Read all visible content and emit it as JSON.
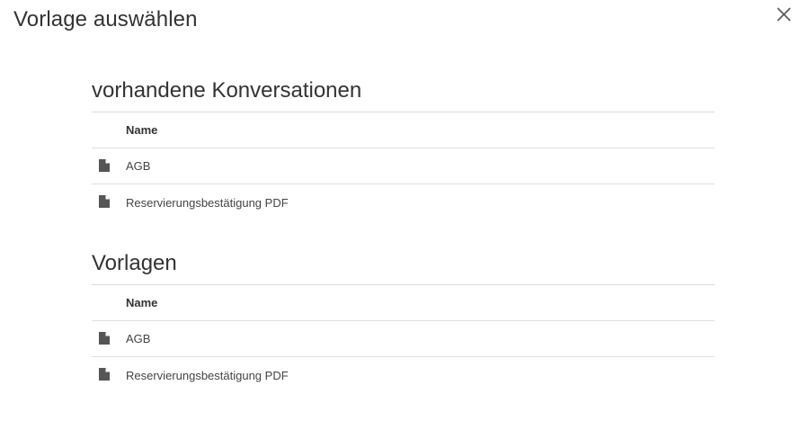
{
  "dialog": {
    "title": "Vorlage auswählen"
  },
  "sections": [
    {
      "heading": "vorhandene Konversationen",
      "column_header": "Name",
      "rows": [
        {
          "name": "AGB",
          "icon": "file-icon"
        },
        {
          "name": "Reservierungsbestätigung PDF",
          "icon": "file-icon"
        }
      ]
    },
    {
      "heading": "Vorlagen",
      "column_header": "Name",
      "rows": [
        {
          "name": "AGB",
          "icon": "file-icon"
        },
        {
          "name": "Reservierungsbestätigung PDF",
          "icon": "file-icon"
        }
      ]
    }
  ],
  "colors": {
    "text": "#333333",
    "divider": "#e0e0e0",
    "icon": "#555555"
  }
}
